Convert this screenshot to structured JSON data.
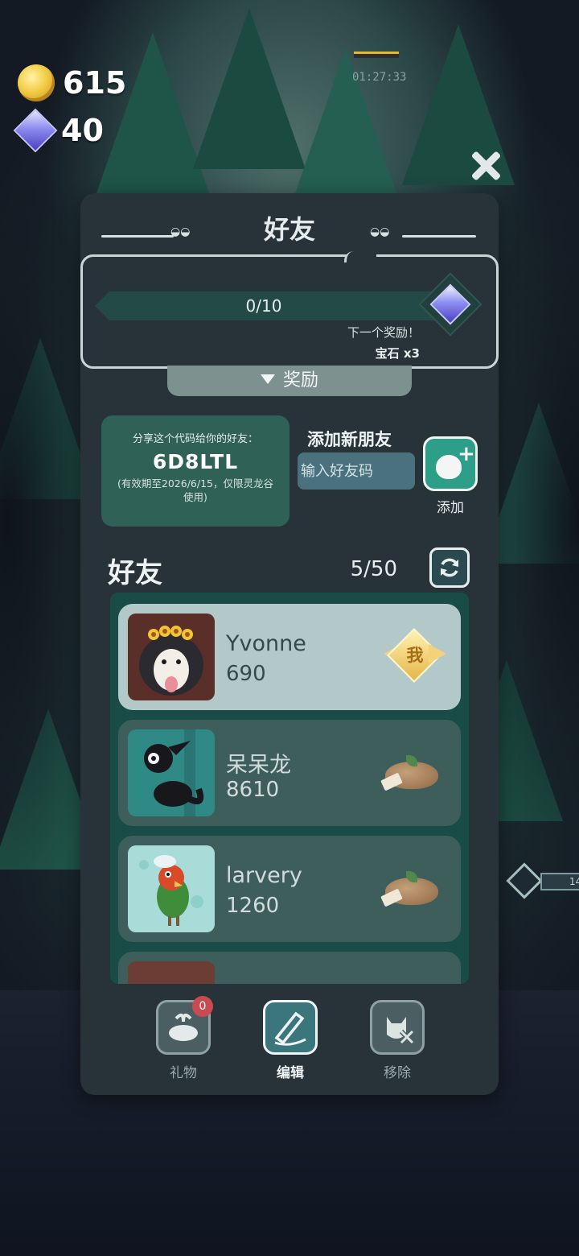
{
  "hud": {
    "gold": "615",
    "gems": "40",
    "timer": "01:27:33",
    "right_meter_value": "14"
  },
  "dialog": {
    "title": "好友",
    "progress": {
      "text": "0/10",
      "current": 0,
      "max": 10
    },
    "next_reward_label": "下一个奖励！",
    "next_reward_item": "宝石 x3",
    "reward_toggle_label": "奖励",
    "share": {
      "label": "分享这个代码给你的好友：",
      "code": "6D8LTL",
      "note": "(有效期至2026/6/15，仅限灵龙谷使用)"
    },
    "add_friend": {
      "title": "添加新朋友",
      "input_placeholder": "输入好友码",
      "input_value": "",
      "button_label": "添加"
    },
    "friends_header": {
      "title": "好友",
      "count": "5/50"
    },
    "friends": [
      {
        "name": "Yvonne",
        "score": "690",
        "is_me": true,
        "badge": "我"
      },
      {
        "name": "呆呆龙",
        "score": "8610",
        "is_me": false
      },
      {
        "name": "larvery",
        "score": "1260",
        "is_me": false
      }
    ],
    "actions": {
      "gift_label": "礼物",
      "gift_badge": "0",
      "edit_label": "编辑",
      "remove_label": "移除"
    }
  },
  "colors": {
    "panel_bg": "#273338",
    "accent_teal": "#2d9f88",
    "share_card": "#2f6157",
    "me_card": "#b3c8c8",
    "friend_card": "#3e5e5b",
    "notification": "#c84b52"
  }
}
